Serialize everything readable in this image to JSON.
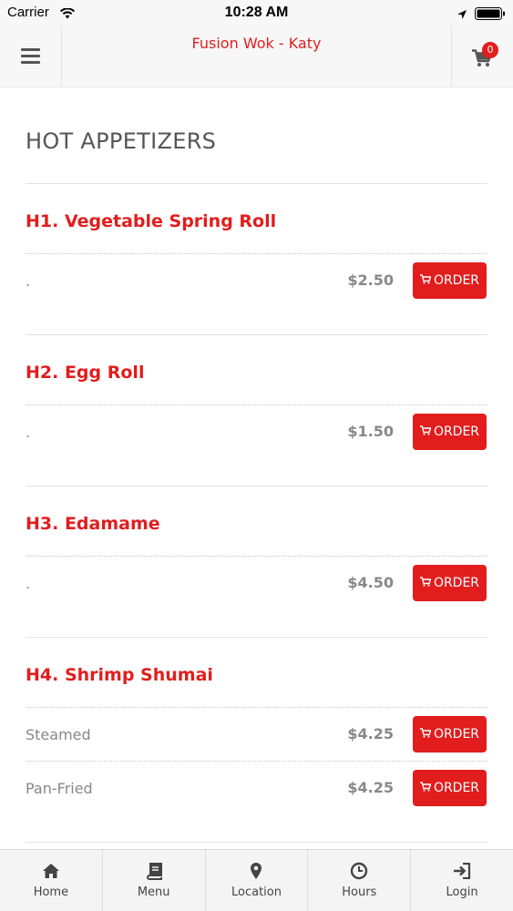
{
  "status_bar": {
    "carrier": "Carrier",
    "time": "10:28 AM"
  },
  "header": {
    "title": "Fusion Wok - Katy",
    "cart_count": "0",
    "menu_icon": "hamburger-icon",
    "cart_icon": "cart-icon"
  },
  "section": {
    "title": "HOT APPETIZERS"
  },
  "items": [
    {
      "name": "H1. Vegetable Spring Roll",
      "variants": [
        {
          "label": ".",
          "price": "$2.50",
          "order_label": "ORDER"
        }
      ]
    },
    {
      "name": "H2. Egg Roll",
      "variants": [
        {
          "label": ".",
          "price": "$1.50",
          "order_label": "ORDER"
        }
      ]
    },
    {
      "name": "H3. Edamame",
      "variants": [
        {
          "label": ".",
          "price": "$4.50",
          "order_label": "ORDER"
        }
      ]
    },
    {
      "name": "H4. Shrimp Shumai",
      "variants": [
        {
          "label": "Steamed",
          "price": "$4.25",
          "order_label": "ORDER"
        },
        {
          "label": "Pan-Fried",
          "price": "$4.25",
          "order_label": "ORDER"
        }
      ]
    }
  ],
  "bottom_nav": [
    {
      "label": "Home",
      "icon": "home-icon"
    },
    {
      "label": "Menu",
      "icon": "book-icon"
    },
    {
      "label": "Location",
      "icon": "map-pin-icon"
    },
    {
      "label": "Hours",
      "icon": "clock-icon"
    },
    {
      "label": "Login",
      "icon": "login-icon"
    }
  ],
  "colors": {
    "accent": "#e21d1d",
    "muted_text": "#888888",
    "header_bg": "#f7f7f7"
  }
}
